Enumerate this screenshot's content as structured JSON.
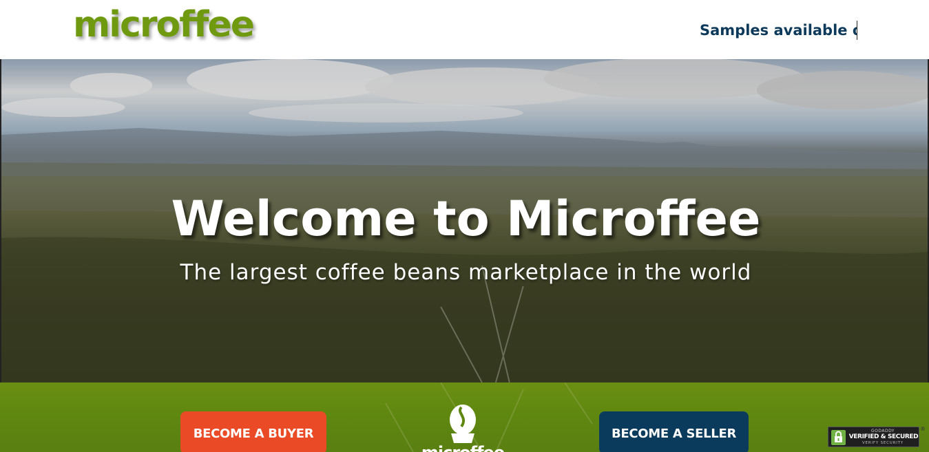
{
  "header": {
    "logo_text": "microffee",
    "ticker_text": "Samples available o"
  },
  "hero": {
    "title": "Welcome to Microffee",
    "subtitle": "The largest coffee beans marketplace in the world"
  },
  "cta": {
    "buyer_label": "BECOME A BUYER",
    "seller_label": "BECOME A SELLER",
    "center_logo_text": "microffee"
  },
  "seal": {
    "brand": "GODADDY",
    "main": "VERIFIED & SECURED",
    "sub": "VERIFY SECURITY",
    "registered": "®"
  },
  "colors": {
    "brand_green": "#6f9a10",
    "ticker_navy": "#0d3a5a",
    "buyer_orange": "#ea4a25",
    "seller_navy": "#0b3b5c",
    "band_green": "#5e8710"
  }
}
